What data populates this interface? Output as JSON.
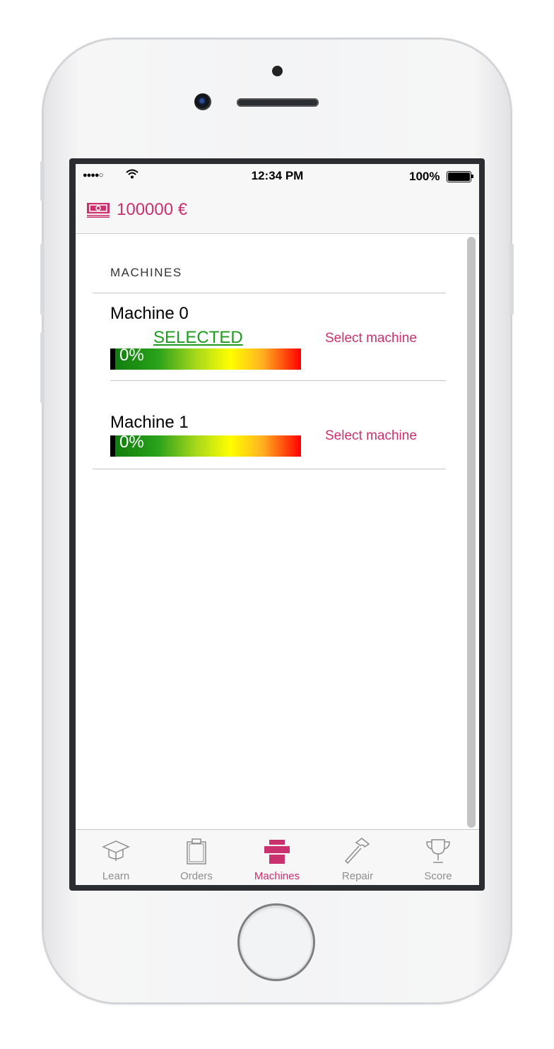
{
  "status_bar": {
    "signal": "●●●●○",
    "time": "12:34 PM",
    "battery": "100%"
  },
  "header": {
    "money": "100000 €",
    "icon": "money-icon"
  },
  "section": {
    "title": "MACHINES"
  },
  "machines": [
    {
      "name": "Machine 0",
      "selected_label": "SELECTED",
      "progress_text": "0%",
      "progress": 0,
      "action": "Select machine"
    },
    {
      "name": "Machine 1",
      "progress_text": "0%",
      "progress": 0,
      "action": "Select machine"
    }
  ],
  "tabs": [
    {
      "label": "Learn",
      "icon": "graduation-cap-icon"
    },
    {
      "label": "Orders",
      "icon": "clipboard-icon"
    },
    {
      "label": "Machines",
      "icon": "printer-icon",
      "active": true
    },
    {
      "label": "Repair",
      "icon": "hammer-icon"
    },
    {
      "label": "Score",
      "icon": "trophy-icon"
    }
  ],
  "colors": {
    "accent": "#c9316f",
    "selected": "#1f9b1f"
  }
}
